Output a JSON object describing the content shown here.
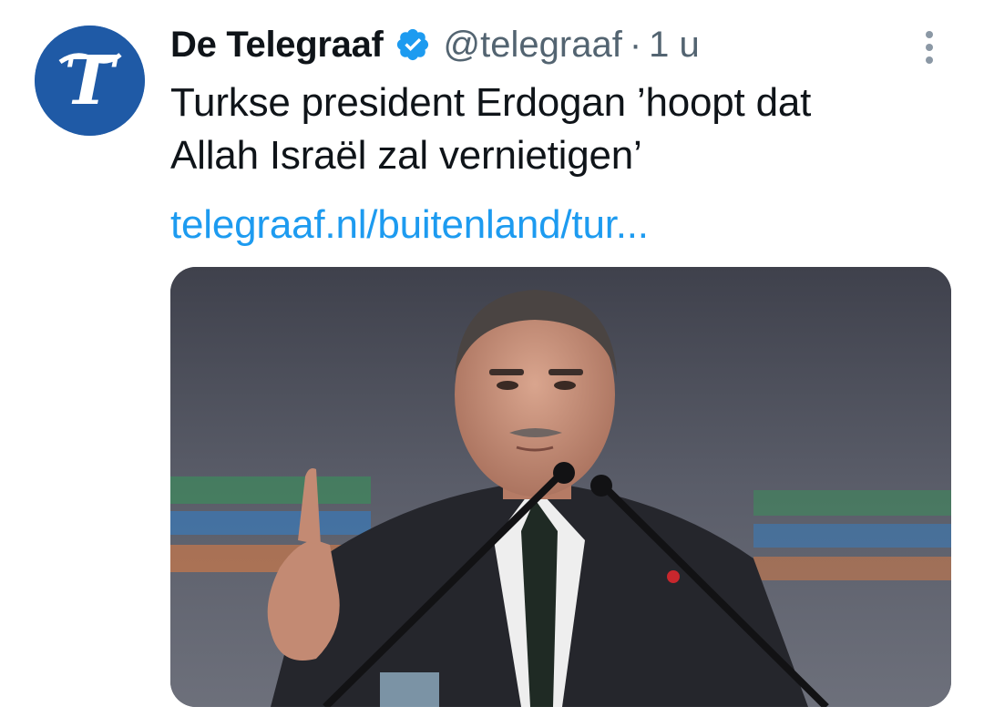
{
  "tweet": {
    "author": {
      "display_name": "De Telegraaf",
      "handle": "@telegraaf",
      "verified": true,
      "avatar_icon": "telegraaf-logo",
      "avatar_color": "#1f5aa6"
    },
    "separator": "·",
    "timestamp": "1 u",
    "text_lines": [
      "Turkse president Erdogan ’hoopt dat",
      "Allah Israël zal vernietigen’"
    ],
    "link": "telegraaf.nl/buitenland/tur...",
    "media_icon": "photo-of-speaker-at-podium"
  },
  "colors": {
    "link": "#1d9bf0",
    "verified": "#1d9bf0",
    "secondary_text": "#536471"
  }
}
